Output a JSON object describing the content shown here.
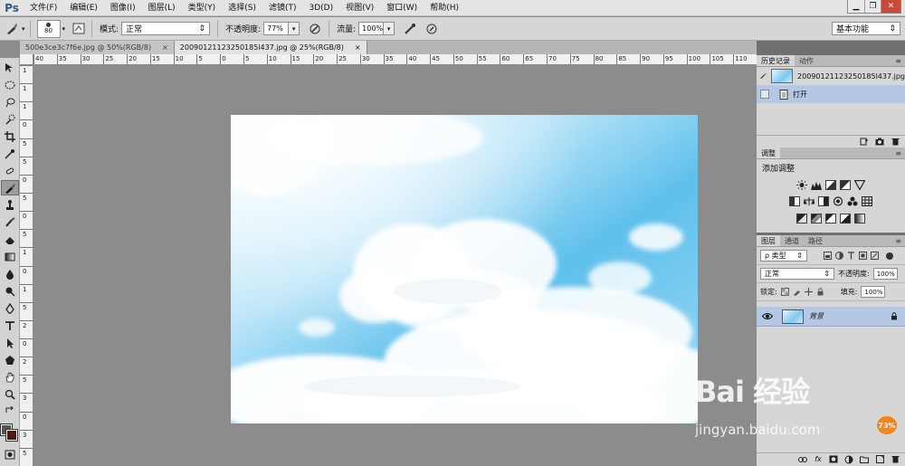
{
  "app": {
    "logo": "Ps"
  },
  "menubar": {
    "items": [
      "文件(F)",
      "编辑(E)",
      "图像(I)",
      "图层(L)",
      "类型(Y)",
      "选择(S)",
      "滤镜(T)",
      "3D(D)",
      "视图(V)",
      "窗口(W)",
      "帮助(H)"
    ]
  },
  "window_controls": {
    "minimize": "▁",
    "restore": "❐",
    "close": "✕"
  },
  "options": {
    "brush_size": "80",
    "mode_label": "模式:",
    "mode_value": "正常",
    "opacity_label": "不透明度:",
    "opacity_value": "77%",
    "flow_label": "流量:",
    "flow_value": "100%",
    "workspace": "基本功能"
  },
  "tabs": [
    {
      "label": "500e3ce3c7f6e.jpg @ 50%(RGB/8)",
      "close": "×",
      "active": false
    },
    {
      "label": "20090121123250185l437.jpg @ 25%(RGB/8)",
      "close": "×",
      "active": true
    }
  ],
  "ruler_h": [
    "40",
    "35",
    "30",
    "25",
    "20",
    "15",
    "10",
    "5",
    "0",
    "5",
    "10",
    "15",
    "20",
    "25",
    "30",
    "35",
    "40",
    "45",
    "50",
    "55",
    "60",
    "65",
    "70",
    "75",
    "80",
    "85",
    "90",
    "95",
    "100",
    "105",
    "110"
  ],
  "ruler_v": [
    "1",
    "1",
    "1",
    "0",
    "5",
    "5",
    "0",
    "5",
    "0",
    "5",
    "1",
    "0",
    "1",
    "5",
    "2",
    "0",
    "2",
    "5",
    "3",
    "0",
    "3",
    "5"
  ],
  "history_panel": {
    "tabs": [
      "历史记录",
      "动作"
    ],
    "snapshot_name": "20090121123250185l437.jpg",
    "open_step": "打开"
  },
  "adjustments_panel": {
    "tab": "调整",
    "title": "添加调整"
  },
  "layers_panel": {
    "tabs": [
      "图层",
      "通道",
      "路径"
    ],
    "filter_kind": "ρ 类型",
    "blend_mode": "正常",
    "opacity_label": "不透明度:",
    "opacity_value": "100%",
    "lock_label": "锁定:",
    "fill_label": "填充:",
    "fill_value": "100%",
    "layer_name": "背景"
  },
  "watermark": {
    "logo": "Bai 经验",
    "url": "jingyan.baidu.com"
  },
  "zoom_badge": "73%"
}
